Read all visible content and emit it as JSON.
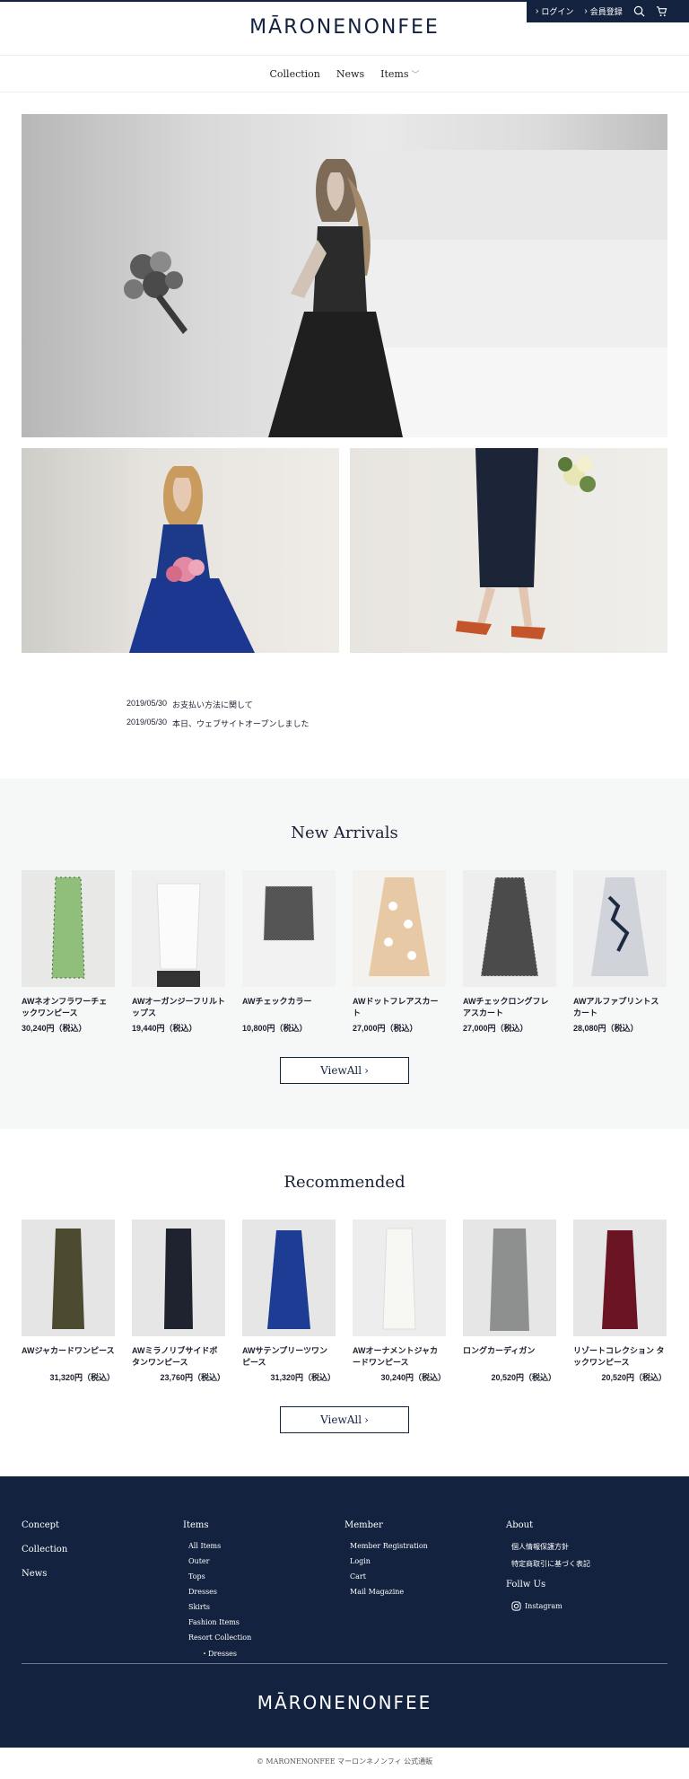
{
  "header": {
    "logo": "MĀRONENONFEE",
    "login": "ログイン",
    "register": "会員登録"
  },
  "nav": [
    "Collection",
    "News",
    "Items"
  ],
  "news": [
    {
      "date": "2019/05/30",
      "title": "お支払い方法に関して"
    },
    {
      "date": "2019/05/30",
      "title": "本日、ウェブサイトオープンしました"
    }
  ],
  "new_arrivals": {
    "title": "New Arrivals",
    "view_all": "ViewAll",
    "items": [
      {
        "name": "AWネオンフラワーチェックワンピース",
        "price": "30,240円（税込）"
      },
      {
        "name": "AWオーガンジーフリルトップス",
        "price": "19,440円（税込）"
      },
      {
        "name": "AWチェックカラー",
        "price": "10,800円（税込）"
      },
      {
        "name": "AWドットフレアスカート",
        "price": "27,000円（税込）"
      },
      {
        "name": "AWチェックロングフレアスカート",
        "price": "27,000円（税込）"
      },
      {
        "name": "AWアルファプリントスカート",
        "price": "28,080円（税込）"
      }
    ]
  },
  "recommended": {
    "title": "Recommended",
    "view_all": "ViewAll",
    "items": [
      {
        "name": "AWジャカードワンピース",
        "price": "31,320円（税込）"
      },
      {
        "name": "AWミラノリブサイドボタンワンピース",
        "price": "23,760円（税込）"
      },
      {
        "name": "AWサテンプリーツワンピース",
        "price": "31,320円（税込）"
      },
      {
        "name": "AWオーナメントジャカードワンピース",
        "price": "30,240円（税込）"
      },
      {
        "name": "ロングカーディガン",
        "price": "20,520円（税込）"
      },
      {
        "name": "リゾートコレクション タックワンピース",
        "price": "20,520円（税込）"
      }
    ]
  },
  "footer": {
    "col1": [
      "Concept",
      "Collection",
      "News"
    ],
    "items_head": "Items",
    "items": [
      "All Items",
      "Outer",
      "Tops",
      "Dresses",
      "Skirts",
      "Fashion Items",
      "Resort Collection"
    ],
    "items_sub": "Dresses",
    "member_head": "Member",
    "member": [
      "Member Registration",
      "Login",
      "Cart",
      "Mail Magazine"
    ],
    "about_head": "About",
    "about": [
      "個人情報保護方針",
      "特定商取引に基づく表記"
    ],
    "follow_head": "Follw Us",
    "instagram": "Instagram",
    "logo": "MĀRONENONFEE",
    "copyright": "© MARONENONFEE マーロンネノンフィ 公式通販"
  },
  "colors": {
    "navy": "#13223f",
    "section_bg": "#f6f7f7"
  }
}
